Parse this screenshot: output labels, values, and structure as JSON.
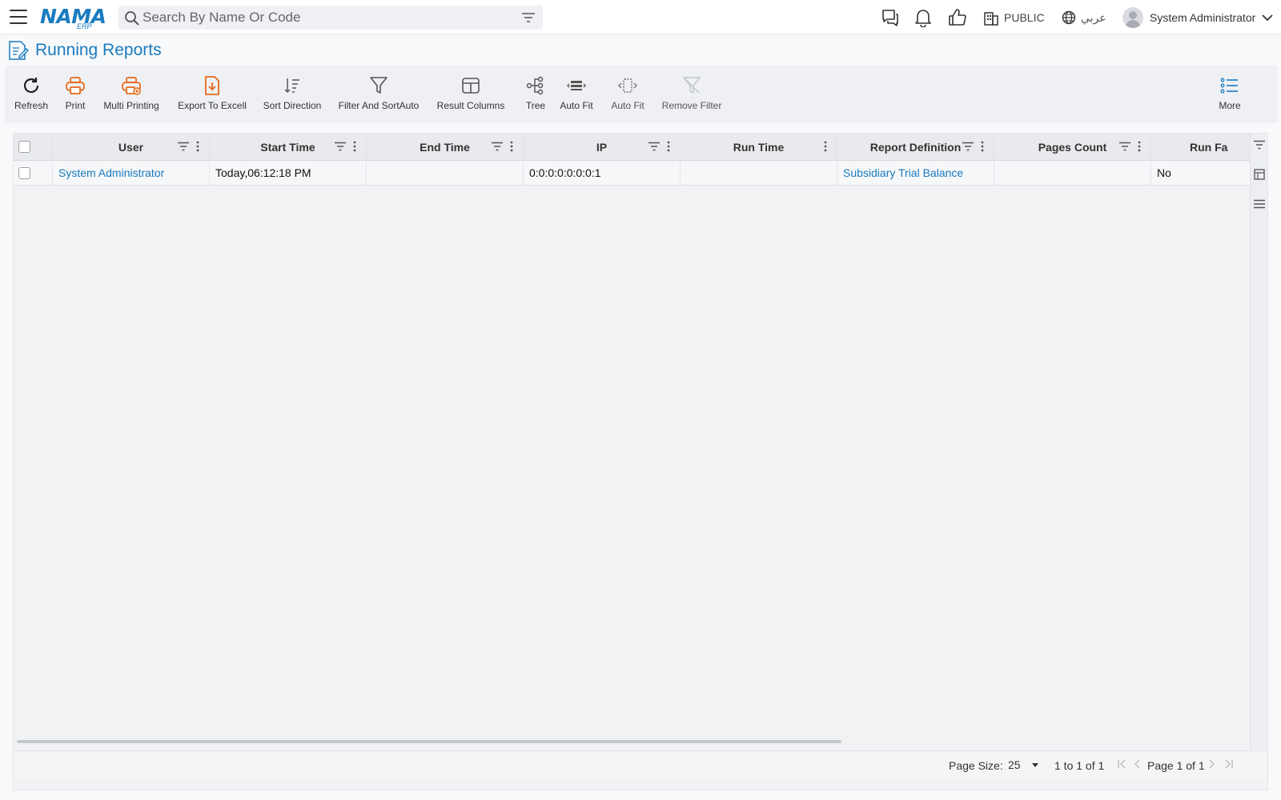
{
  "app": {
    "logo_main": "NAMA",
    "logo_sub": "ERP"
  },
  "topbar": {
    "search_placeholder": "Search By Name Or Code",
    "company": "PUBLIC",
    "language": "عربي",
    "user_name": "System Administrator"
  },
  "page": {
    "title": "Running Reports"
  },
  "toolbar": {
    "refresh": "Refresh",
    "print": "Print",
    "multi_printing": "Multi Printing",
    "export_excel": "Export To Excell",
    "sort_direction": "Sort Direction",
    "filter_sort": "Filter And SortAuto",
    "result_columns": "Result Columns",
    "tree": "Tree",
    "auto_fit_1": "Auto Fit",
    "auto_fit_2": "Auto Fit",
    "remove_filter": "Remove Filter",
    "more": "More"
  },
  "grid": {
    "columns": {
      "user": "User",
      "start_time": "Start Time",
      "end_time": "End Time",
      "ip": "IP",
      "run_time": "Run Time",
      "report_definition": "Report Definition",
      "pages_count": "Pages Count",
      "run_failed": "Run Fa"
    },
    "rows": [
      {
        "user": "System Administrator",
        "start_time": "Today,06:12:18 PM",
        "end_time": "",
        "ip": "0:0:0:0:0:0:0:1",
        "run_time": "",
        "report_definition": "Subsidiary Trial Balance",
        "pages_count": "",
        "run_failed": "No"
      }
    ]
  },
  "pagination": {
    "page_size_label": "Page Size:",
    "page_size": "25",
    "range": "1 to 1 of 1",
    "page_info": "Page 1 of 1"
  },
  "colors": {
    "accent": "#1a7bbf",
    "orange_icon": "#e8681a"
  }
}
